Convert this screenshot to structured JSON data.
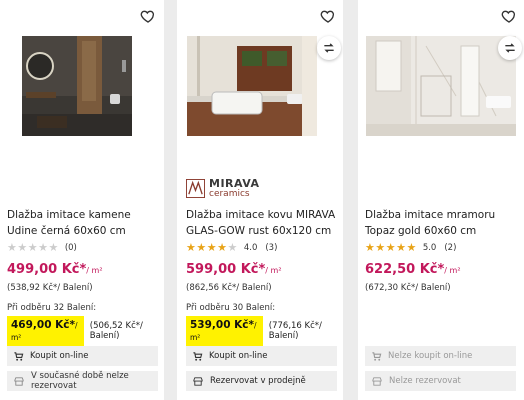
{
  "products": [
    {
      "title": "Dlažba imitace kamene Udine černá 60x60 cm",
      "rating": "",
      "reviews": "(0)",
      "stars_on": 0,
      "price": "499,00 Kč*",
      "price_unit": "/ m²",
      "price_per_pack": "(538,92 Kč*/ Balení)",
      "bulk_label": "Při odběru 32 Balení:",
      "bulk_price": "469,00 Kč*",
      "bulk_unit": "/ m²",
      "bulk_per_pack": "(506,52 Kč*/ Balení)",
      "btn_online": "Koupit on-line",
      "btn_reserve": "V současné době nelze rezervovat",
      "online_disabled": false,
      "reserve_disabled": true,
      "favorite_icon": "heart-outline-icon",
      "compare_icon": "compare-arrows-icon"
    },
    {
      "brand_line1": "MIRAVA",
      "brand_line2": "ceramics",
      "title": "Dlažba imitace kovu MIRAVA GLAS-GOW rust 60x120 cm",
      "rating": "4.0",
      "reviews": "(3)",
      "stars_on": 4,
      "price": "599,00 Kč*",
      "price_unit": "/ m²",
      "price_per_pack": "(862,56 Kč*/ Balení)",
      "bulk_label": "Při odběru 30 Balení:",
      "bulk_price": "539,00 Kč*",
      "bulk_unit": "/ m²",
      "bulk_per_pack": "(776,16 Kč*/ Balení)",
      "btn_online": "Koupit on-line",
      "btn_reserve": "Rezervovat v prodejně",
      "online_disabled": false,
      "reserve_disabled": false
    },
    {
      "title": "Dlažba imitace mramoru Topaz gold 60x60 cm",
      "rating": "5.0",
      "reviews": "(2)",
      "stars_on": 5,
      "price": "622,50 Kč*",
      "price_unit": "/ m²",
      "price_per_pack": "(672,30 Kč*/ Balení)",
      "btn_online": "Nelze koupit on-line",
      "btn_reserve": "Nelze rezervovat",
      "online_disabled": true,
      "reserve_disabled": true
    }
  ],
  "colors": {
    "price": "#c2185b",
    "highlight": "#fff200",
    "star": "#e8a317",
    "button_bg": "#efefef"
  }
}
